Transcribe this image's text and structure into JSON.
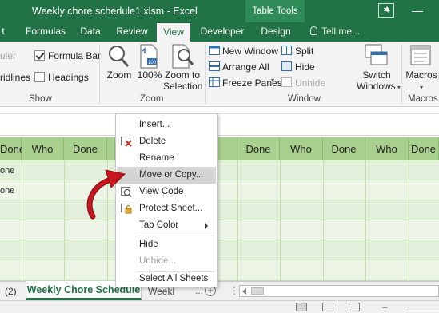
{
  "title_bar": {
    "title": "Weekly chore schedule1.xlsm - Excel",
    "context_tab": "Table Tools"
  },
  "ribbon_tabs": [
    {
      "label": "Formulas"
    },
    {
      "label": "Data"
    },
    {
      "label": "Review"
    },
    {
      "label": "View",
      "active": true
    },
    {
      "label": "Developer"
    },
    {
      "label": "Design"
    }
  ],
  "tell_me": "Tell me...",
  "show_group": {
    "label": "Show",
    "ruler": "uler",
    "gridlines": "ridlines",
    "formula_bar": "Formula Bar",
    "headings": "Headings"
  },
  "zoom_group": {
    "label": "Zoom",
    "zoom": "Zoom",
    "hundred": "100%",
    "zoom_to_selection_line1": "Zoom to",
    "zoom_to_selection_line2": "Selection"
  },
  "window_group": {
    "label": "Window",
    "new_window": "New Window",
    "arrange_all": "Arrange All",
    "freeze_panes": "Freeze Panes",
    "split": "Split",
    "hide": "Hide",
    "unhide": "Unhide",
    "switch_windows_line1": "Switch",
    "switch_windows_line2": "Windows"
  },
  "macros_group": {
    "label": "Macros",
    "macros": "Macros"
  },
  "grid": {
    "headers": [
      "Done",
      "Who",
      "Done",
      "Who",
      "Done",
      "Who",
      "Done",
      "Who",
      "Done"
    ],
    "row_labels": [
      "one",
      "one"
    ]
  },
  "context_menu": {
    "items": [
      {
        "label": "Insert...",
        "icon": "none"
      },
      {
        "label": "Delete",
        "icon": "delete-sheet-icon"
      },
      {
        "label": "Rename",
        "icon": "none"
      },
      {
        "label": "Move or Copy...",
        "icon": "none",
        "highlighted": true
      },
      {
        "label": "View Code",
        "icon": "view-code-icon"
      },
      {
        "label": "Protect Sheet...",
        "icon": "protect-sheet-icon"
      },
      {
        "label": "Tab Color",
        "icon": "none",
        "submenu": true
      },
      {
        "label": "Hide",
        "icon": "none"
      },
      {
        "label": "Unhide...",
        "icon": "none",
        "disabled": true
      },
      {
        "label": "Select All Sheets",
        "icon": "none"
      }
    ]
  },
  "sheet_tabs": {
    "count_label": "(2)",
    "active": "Weekly Chore Schedule",
    "next": "Weekl",
    "more": "...",
    "add": "+"
  },
  "colors": {
    "excel_green": "#217346",
    "header_green": "#a9d08e",
    "row_green": "#e2efda",
    "arrow_red": "#b5121b"
  }
}
